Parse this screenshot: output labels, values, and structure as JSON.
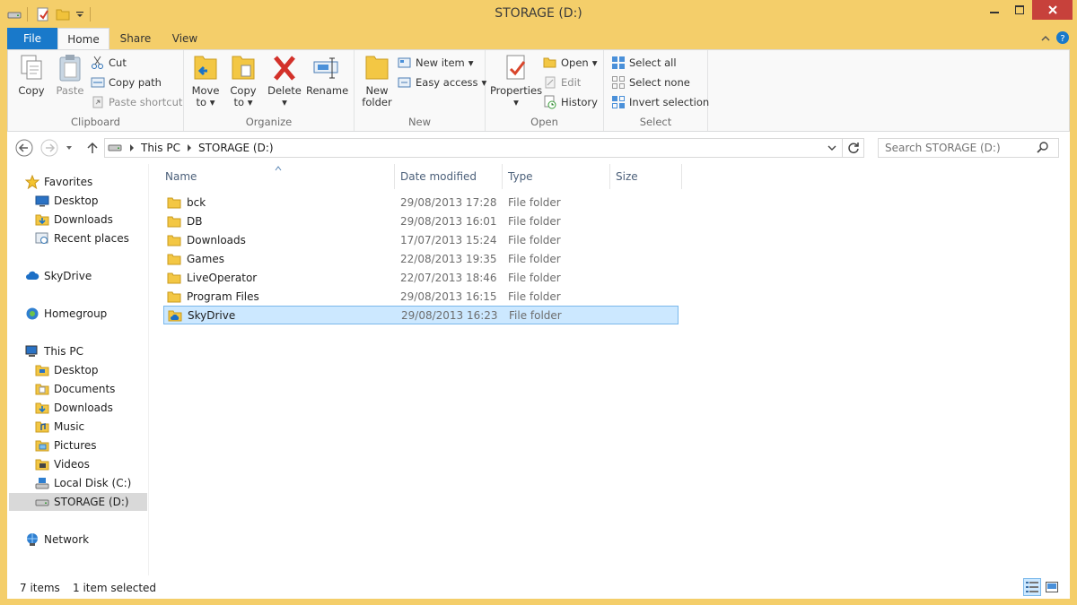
{
  "window": {
    "title": "STORAGE (D:)"
  },
  "ribbon": {
    "tabs": [
      "File",
      "Home",
      "Share",
      "View"
    ],
    "clipboard": {
      "label": "Clipboard",
      "copy": "Copy",
      "paste": "Paste",
      "cut": "Cut",
      "copy_path": "Copy path",
      "paste_shortcut": "Paste shortcut"
    },
    "organize": {
      "label": "Organize",
      "move_to_1": "Move",
      "move_to_2": "to",
      "copy_to_1": "Copy",
      "copy_to_2": "to",
      "delete": "Delete",
      "rename": "Rename"
    },
    "new": {
      "label": "New",
      "new_folder_1": "New",
      "new_folder_2": "folder",
      "new_item": "New item",
      "easy_access": "Easy access"
    },
    "open": {
      "label": "Open",
      "properties": "Properties",
      "open": "Open",
      "edit": "Edit",
      "history": "History"
    },
    "select": {
      "label": "Select",
      "select_all": "Select all",
      "select_none": "Select none",
      "invert": "Invert selection"
    }
  },
  "address": {
    "crumbs": [
      "This PC",
      "STORAGE (D:)"
    ],
    "search_placeholder": "Search STORAGE (D:)"
  },
  "nav": {
    "favorites": "Favorites",
    "fav_items": [
      "Desktop",
      "Downloads",
      "Recent places"
    ],
    "skydrive": "SkyDrive",
    "homegroup": "Homegroup",
    "this_pc": "This PC",
    "pc_items": [
      "Desktop",
      "Documents",
      "Downloads",
      "Music",
      "Pictures",
      "Videos",
      "Local Disk (C:)",
      "STORAGE (D:)"
    ],
    "network": "Network"
  },
  "columns": {
    "name": "Name",
    "date": "Date modified",
    "type": "Type",
    "size": "Size"
  },
  "files": [
    {
      "name": "bck",
      "date": "29/08/2013 17:28",
      "type": "File folder"
    },
    {
      "name": "DB",
      "date": "29/08/2013 16:01",
      "type": "File folder"
    },
    {
      "name": "Downloads",
      "date": "17/07/2013 15:24",
      "type": "File folder"
    },
    {
      "name": "Games",
      "date": "22/08/2013 19:35",
      "type": "File folder"
    },
    {
      "name": "LiveOperator",
      "date": "22/07/2013 18:46",
      "type": "File folder"
    },
    {
      "name": "Program Files",
      "date": "29/08/2013 16:15",
      "type": "File folder"
    },
    {
      "name": "SkyDrive",
      "date": "29/08/2013 16:23",
      "type": "File folder"
    }
  ],
  "status": {
    "count": "7 items",
    "selected": "1 item selected"
  },
  "colors": {
    "accent": "#1979ca",
    "frame": "#f4ce6a",
    "selection": "#cce8ff",
    "close": "#c7413b"
  }
}
